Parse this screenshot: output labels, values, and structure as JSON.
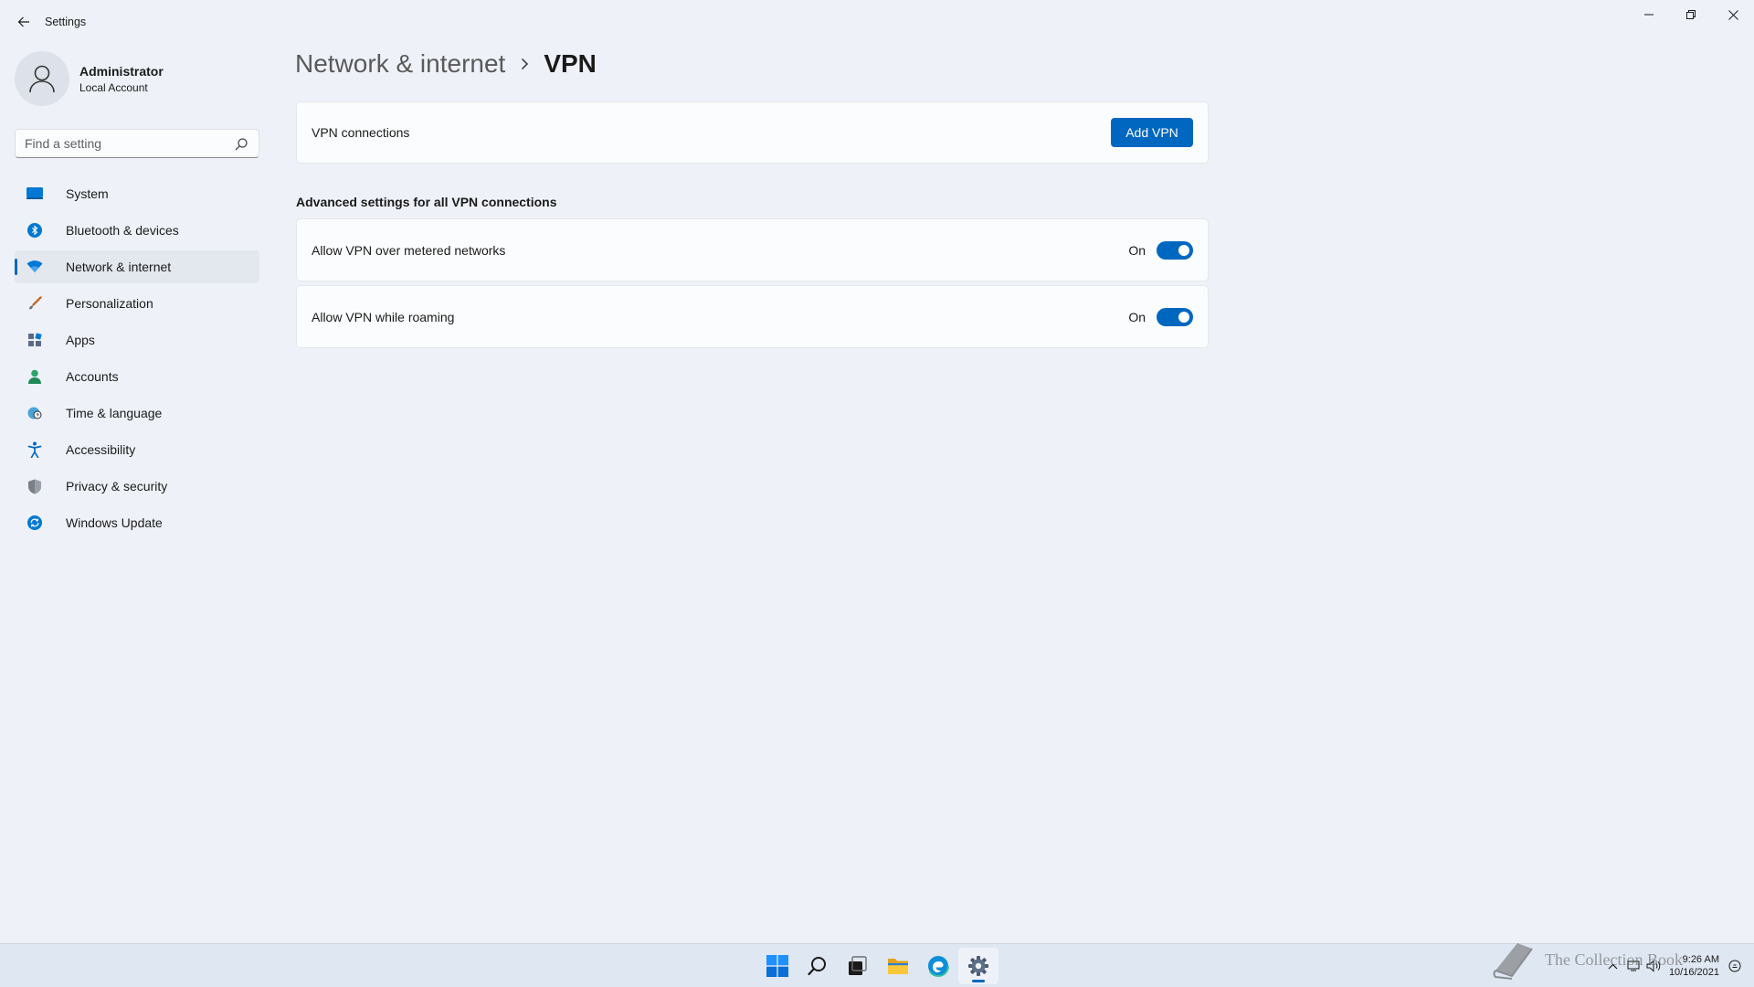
{
  "window": {
    "title": "Settings"
  },
  "profile": {
    "name": "Administrator",
    "account_type": "Local Account"
  },
  "search": {
    "placeholder": "Find a setting"
  },
  "sidebar": {
    "items": [
      {
        "label": "System",
        "icon": "monitor-icon"
      },
      {
        "label": "Bluetooth & devices",
        "icon": "bluetooth-icon"
      },
      {
        "label": "Network & internet",
        "icon": "wifi-icon",
        "active": true
      },
      {
        "label": "Personalization",
        "icon": "brush-icon"
      },
      {
        "label": "Apps",
        "icon": "apps-icon"
      },
      {
        "label": "Accounts",
        "icon": "person-icon"
      },
      {
        "label": "Time & language",
        "icon": "globe-clock-icon"
      },
      {
        "label": "Accessibility",
        "icon": "accessibility-icon"
      },
      {
        "label": "Privacy & security",
        "icon": "shield-icon"
      },
      {
        "label": "Windows Update",
        "icon": "update-icon"
      }
    ]
  },
  "breadcrumb": {
    "parent": "Network & internet",
    "current": "VPN"
  },
  "vpn_connections": {
    "label": "VPN connections",
    "add_button": "Add VPN"
  },
  "advanced": {
    "title": "Advanced settings for all VPN connections",
    "settings": [
      {
        "label": "Allow VPN over metered networks",
        "state": "On"
      },
      {
        "label": "Allow VPN while roaming",
        "state": "On"
      }
    ]
  },
  "taskbar": {
    "time": "9:26 AM",
    "date": "10/16/2021"
  },
  "watermark": {
    "text": "The Collection Book"
  },
  "colors": {
    "accent": "#0067c0",
    "background": "#eef2f8",
    "card": "#fbfcfd"
  }
}
